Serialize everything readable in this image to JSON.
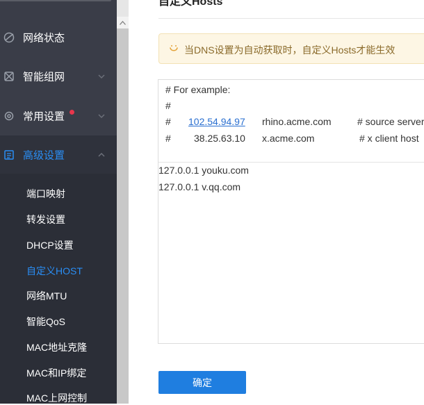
{
  "sidebar": {
    "menu": [
      {
        "label": "网络状态",
        "icon": "globe-icon"
      },
      {
        "label": "智能组网",
        "icon": "mesh-icon"
      },
      {
        "label": "常用设置",
        "icon": "gear-icon"
      },
      {
        "label": "高级设置",
        "icon": "list-icon"
      }
    ],
    "submenu": [
      {
        "label": "端口映射"
      },
      {
        "label": "转发设置"
      },
      {
        "label": "DHCP设置"
      },
      {
        "label": "自定义HOST"
      },
      {
        "label": "网络MTU"
      },
      {
        "label": "智能QoS"
      },
      {
        "label": "MAC地址克隆"
      },
      {
        "label": "MAC和IP绑定"
      },
      {
        "label": "MAC上网控制"
      }
    ]
  },
  "main": {
    "title": "自定义Hosts",
    "notice": "当DNS设置为自动获取时，自定义Hosts才能生效",
    "example": {
      "line1": "# For example:",
      "line2": "#",
      "row3": {
        "hash": "#",
        "ip": "102.54.94.97",
        "host": "rhino.acme.com",
        "comment": "# source server"
      },
      "row4": {
        "hash": "#",
        "ip": "38.25.63.10",
        "host": "x.acme.com",
        "comment": "# x client host"
      }
    },
    "hosts": [
      "127.0.0.1 youku.com",
      "127.0.0.1 v.qq.com"
    ],
    "confirm_label": "确定"
  },
  "colors": {
    "accent": "#2a8ef5",
    "sidebar_bg": "#3a3d48",
    "submenu_bg": "#2b2e37",
    "badge": "#e8364c",
    "button": "#1f7ee0",
    "notice_bg": "#fdf6e4"
  }
}
